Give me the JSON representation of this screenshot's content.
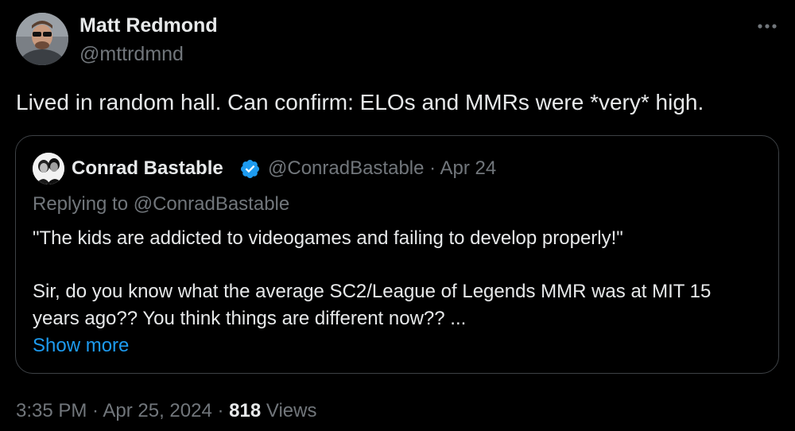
{
  "author": {
    "name": "Matt Redmond",
    "handle": "@mttrdmnd"
  },
  "more_icon": "more-horizontal-icon",
  "tweet_text": "Lived in random hall. Can confirm: ELOs and MMRs were *very* high.",
  "quoted": {
    "name": "Conrad Bastable",
    "verified_icon": "verified-badge-icon",
    "meta": "@ConradBastable · Apr 24",
    "replying_to": "Replying to @ConradBastable",
    "line1": "\"The kids are addicted to videogames and failing to develop properly!\"",
    "line2": "Sir, do you know what the average SC2/League of Legends MMR was at MIT 15",
    "line3": "years ago?? You think things are different now?? ...",
    "show_more": "Show more"
  },
  "footer": {
    "timestamp": "3:35 PM · Apr 25, 2024 · ",
    "views_count": "818",
    "views_label": " Views"
  },
  "colors": {
    "background": "#000000",
    "primary_text": "#e7e9ea",
    "secondary_text": "#71767b",
    "link": "#1d9bf0",
    "border": "#3d4145"
  }
}
